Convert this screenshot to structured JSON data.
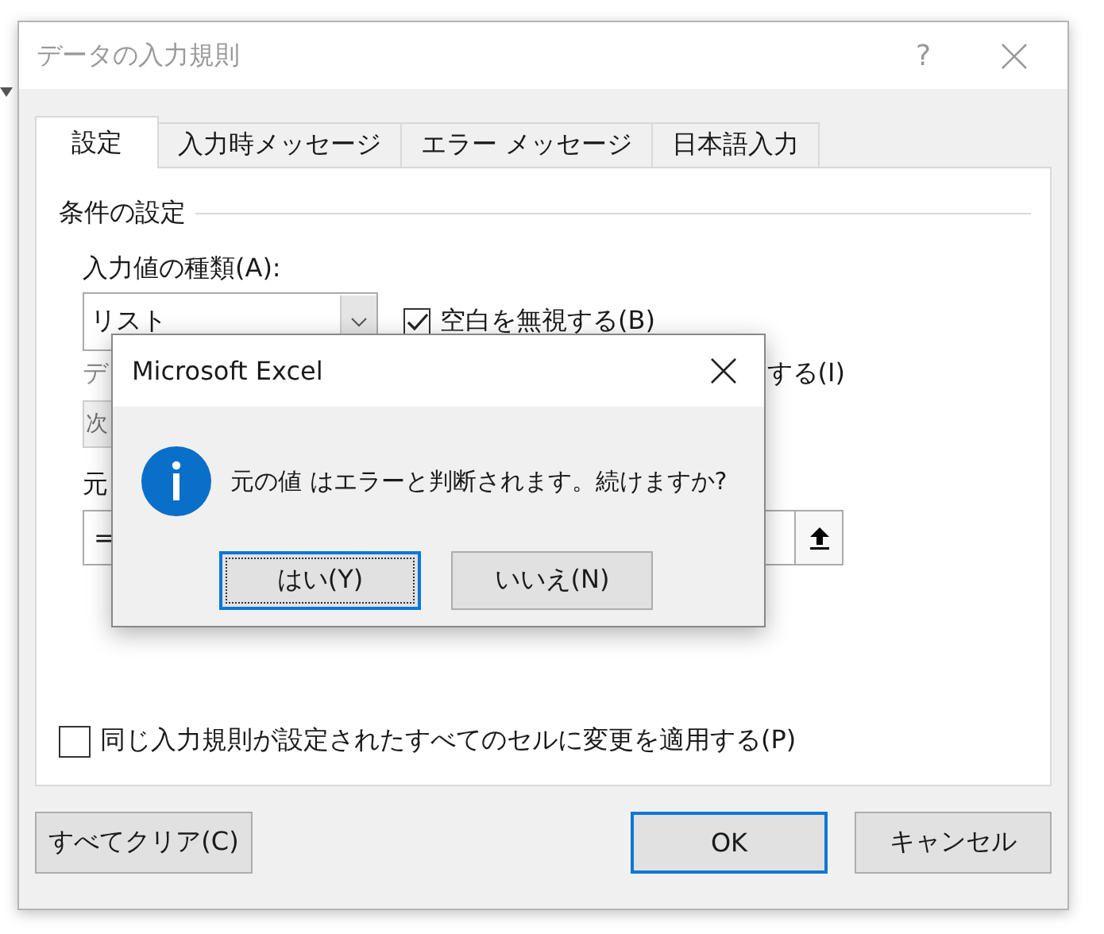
{
  "window": {
    "title": "データの入力規則",
    "help": "?"
  },
  "tabs": [
    {
      "label": "設定",
      "selected": true
    },
    {
      "label": "入力時メッセージ",
      "selected": false
    },
    {
      "label": "エラー メッセージ",
      "selected": false
    },
    {
      "label": "日本語入力",
      "selected": false
    }
  ],
  "settings": {
    "group_title": "条件の設定",
    "type_label": "入力値の種類(A):",
    "type_value": "リスト",
    "ignore_blank": {
      "label": "空白を無視する(B)",
      "checked": true
    },
    "data_label": "デ",
    "dropdown_option_label": "する(I)",
    "data_value": "次",
    "source_label": "元",
    "source_value": "="
  },
  "apply_all": {
    "label": "同じ入力規則が設定されたすべてのセルに変更を適用する(P)",
    "checked": false
  },
  "buttons": [
    {
      "label": "すべてクリア(C)",
      "default": false
    },
    {
      "label": "OK",
      "default": true
    },
    {
      "label": "キャンセル",
      "default": false
    }
  ],
  "alert": {
    "title": "Microsoft Excel",
    "message": "元の値 はエラーと判断されます。続けますか?",
    "buttons": [
      {
        "label": "はい(Y)",
        "default": true
      },
      {
        "label": "いいえ(N)",
        "default": false
      }
    ]
  }
}
